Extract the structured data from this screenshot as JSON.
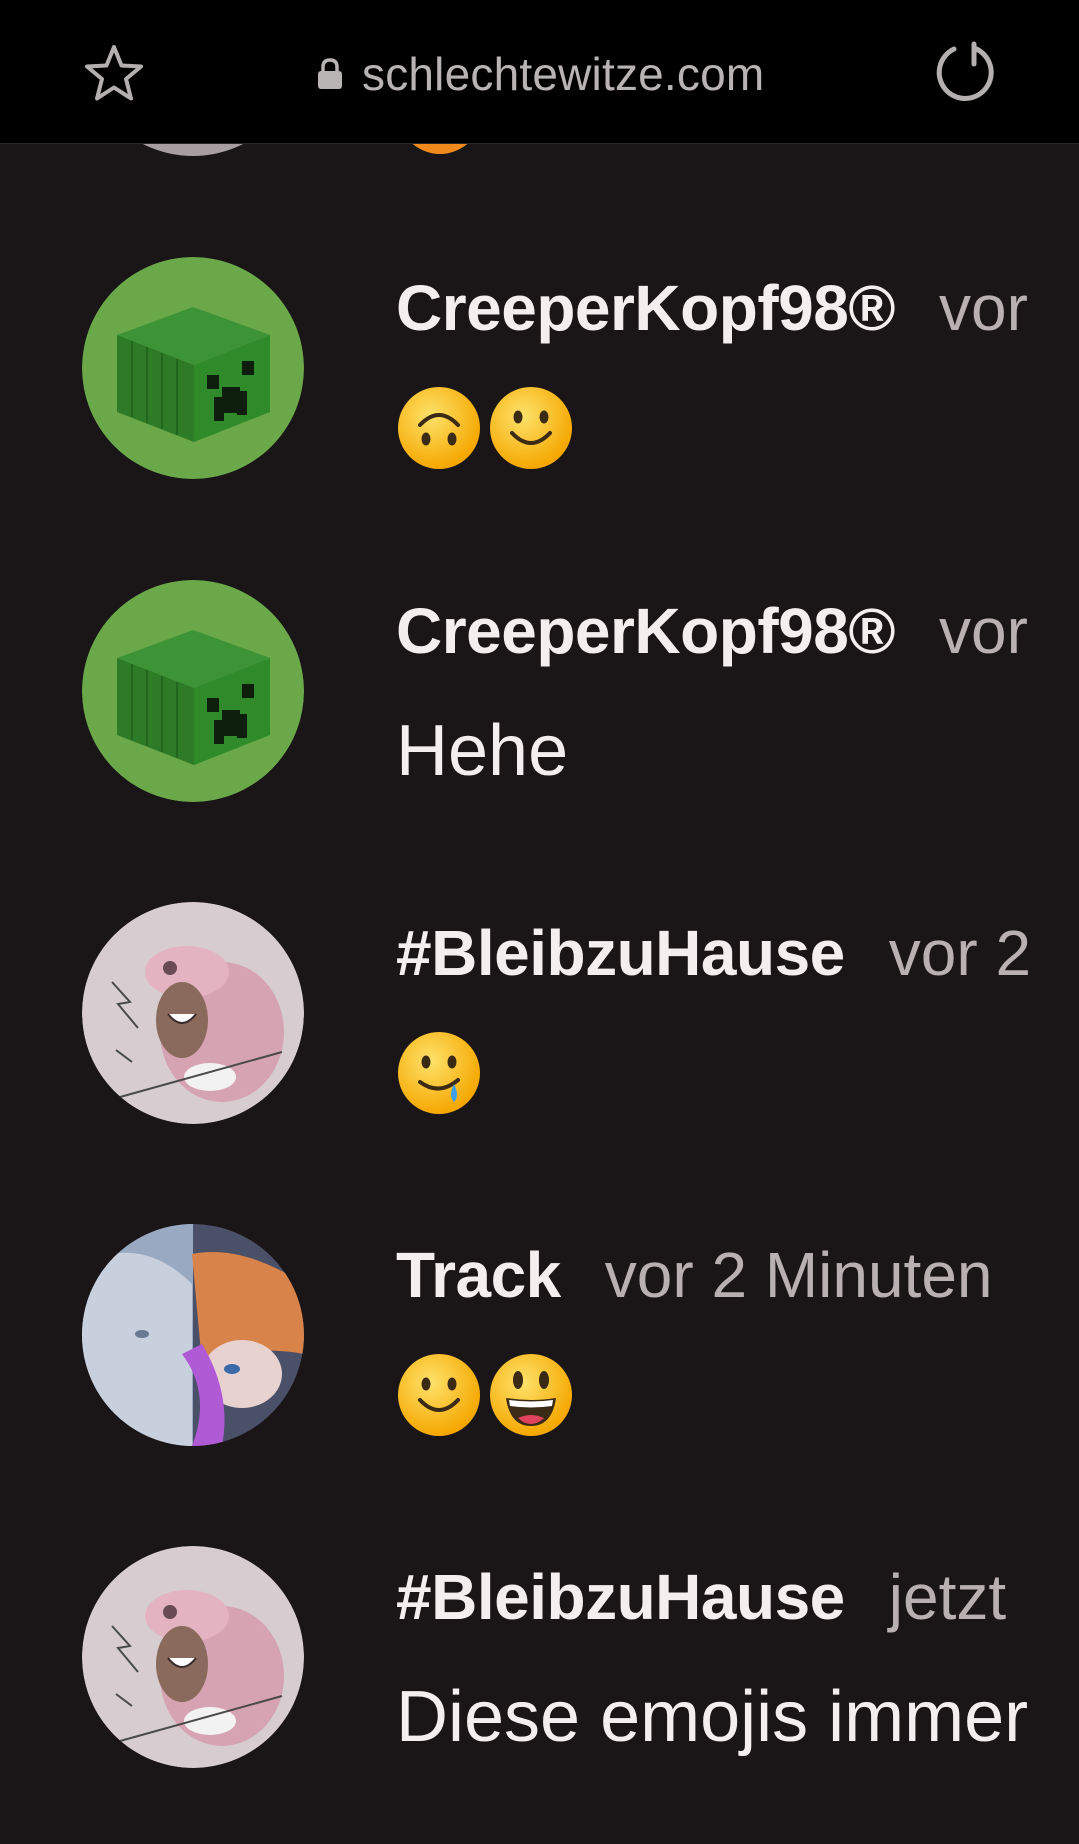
{
  "browser": {
    "url": "schlechtewitze.com"
  },
  "messages": [
    {
      "username": "CreeperKopf98®",
      "timestamp": "vor",
      "avatar": "creeper-avatar",
      "text": "",
      "emojis": [
        "upside-down-face",
        "slightly-smiling-face"
      ]
    },
    {
      "username": "CreeperKopf98®",
      "timestamp": "vor",
      "avatar": "creeper-avatar",
      "text": "Hehe",
      "emojis": []
    },
    {
      "username": "#BleibzuHause",
      "timestamp": "vor 2",
      "avatar": "pink-creature-avatar",
      "text": "",
      "emojis": [
        "smiling-face-with-tear"
      ]
    },
    {
      "username": "Track",
      "timestamp": "vor 2 Minuten",
      "avatar": "anime-avatar",
      "text": "",
      "emojis": [
        "slightly-smiling-face",
        "grinning-face-with-big-eyes"
      ]
    },
    {
      "username": "#BleibzuHause",
      "timestamp": "jetzt",
      "avatar": "pink-creature-avatar",
      "text": "Diese emojis immer",
      "emojis": []
    }
  ],
  "colors": {
    "background": "#1a1516",
    "topbar": "#000000",
    "username": "#f4eeee",
    "timestamp": "#b9b1b1",
    "emoji_yellow": "#fcc21b"
  }
}
